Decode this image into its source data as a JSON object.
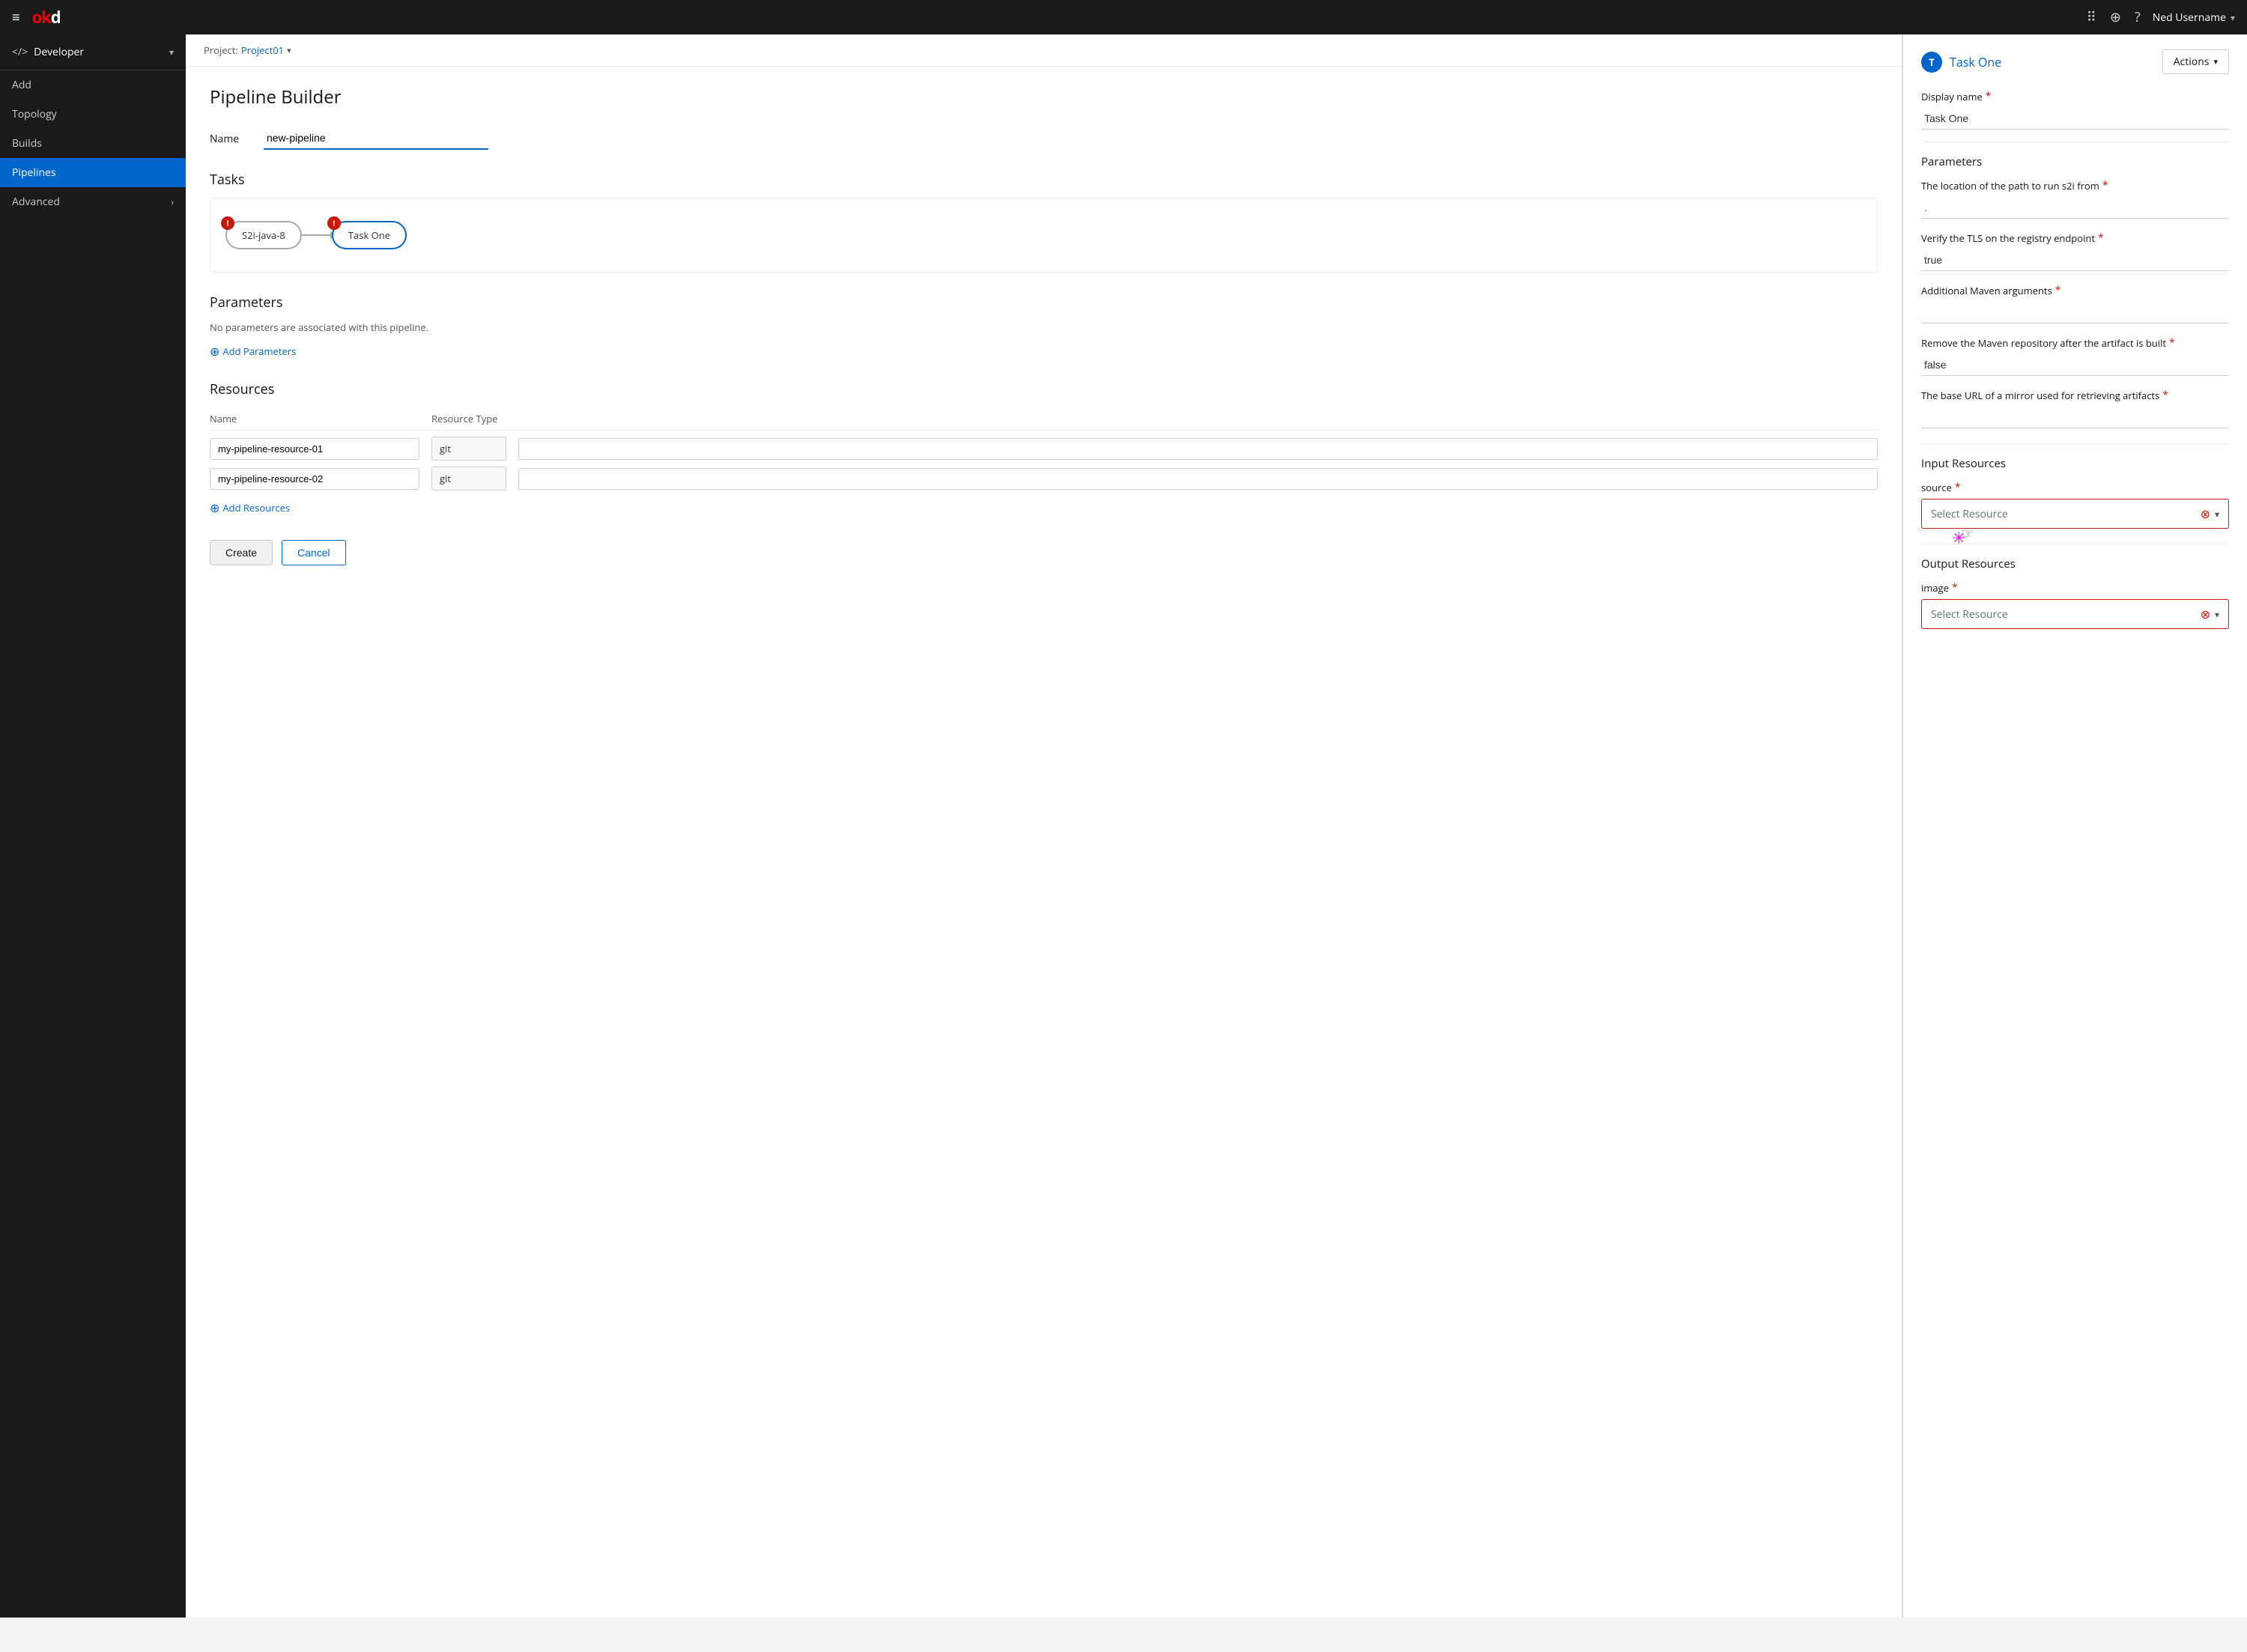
{
  "app": {
    "logo": "okd",
    "logo_prefix": "o"
  },
  "topnav": {
    "hamburger": "≡",
    "user": "Ned Username",
    "user_chevron": "▾"
  },
  "sidebar": {
    "context_icon": "</>",
    "context_label": "Developer",
    "context_chevron": "▾",
    "items": [
      {
        "id": "add",
        "label": "Add",
        "active": false
      },
      {
        "id": "topology",
        "label": "Topology",
        "active": false
      },
      {
        "id": "builds",
        "label": "Builds",
        "active": false
      },
      {
        "id": "pipelines",
        "label": "Pipelines",
        "active": true
      },
      {
        "id": "advanced",
        "label": "Advanced",
        "active": false,
        "arrow": "›"
      }
    ]
  },
  "project_bar": {
    "label": "Project:",
    "name": "Project01",
    "chevron": "▾"
  },
  "page": {
    "title": "Pipeline Builder"
  },
  "name_field": {
    "label": "Name",
    "value": "new-pipeline"
  },
  "tasks": {
    "title": "Tasks",
    "nodes": [
      {
        "id": "s2i",
        "label": "S2i-java-8",
        "has_error": true,
        "selected": false
      },
      {
        "id": "task-one",
        "label": "Task One",
        "has_error": true,
        "selected": true
      }
    ]
  },
  "parameters": {
    "title": "Parameters",
    "empty_text": "No parameters are associated with this pipeline.",
    "add_label": "Add Parameters"
  },
  "resources": {
    "title": "Resources",
    "columns": {
      "name": "Name",
      "type": "Resource Type",
      "value": ""
    },
    "rows": [
      {
        "name": "my-pipeline-resource-01",
        "type": "git",
        "value": ""
      },
      {
        "name": "my-pipeline-resource-02",
        "type": "git",
        "value": ""
      }
    ],
    "add_label": "Add Resources"
  },
  "buttons": {
    "create": "Create",
    "cancel": "Cancel"
  },
  "right_panel": {
    "task_avatar": "T",
    "task_name": "Task One",
    "actions_label": "Actions",
    "actions_chevron": "▾",
    "display_name_label": "Display name",
    "display_name_required": true,
    "display_name_value": "Task One",
    "parameters_section": "Parameters",
    "fields": [
      {
        "id": "path",
        "label": "The location of the path to run s2i from",
        "required": true,
        "value": "."
      },
      {
        "id": "tls",
        "label": "Verify the TLS on the registry endpoint",
        "required": true,
        "value": "true"
      },
      {
        "id": "maven_args",
        "label": "Additional Maven arguments",
        "required": true,
        "value": ""
      },
      {
        "id": "maven_repo",
        "label": "Remove the Maven repository after the artifact is built",
        "required": true,
        "value": "false"
      },
      {
        "id": "mirror_url",
        "label": "The base URL of a mirror used for retrieving artifacts",
        "required": true,
        "value": ""
      }
    ],
    "input_resources_title": "Input Resources",
    "source_label": "source",
    "source_required": true,
    "source_placeholder": "Select Resource",
    "output_resources_title": "Output Resources",
    "image_label": "image",
    "image_required": true,
    "image_placeholder": "Select Resource"
  }
}
